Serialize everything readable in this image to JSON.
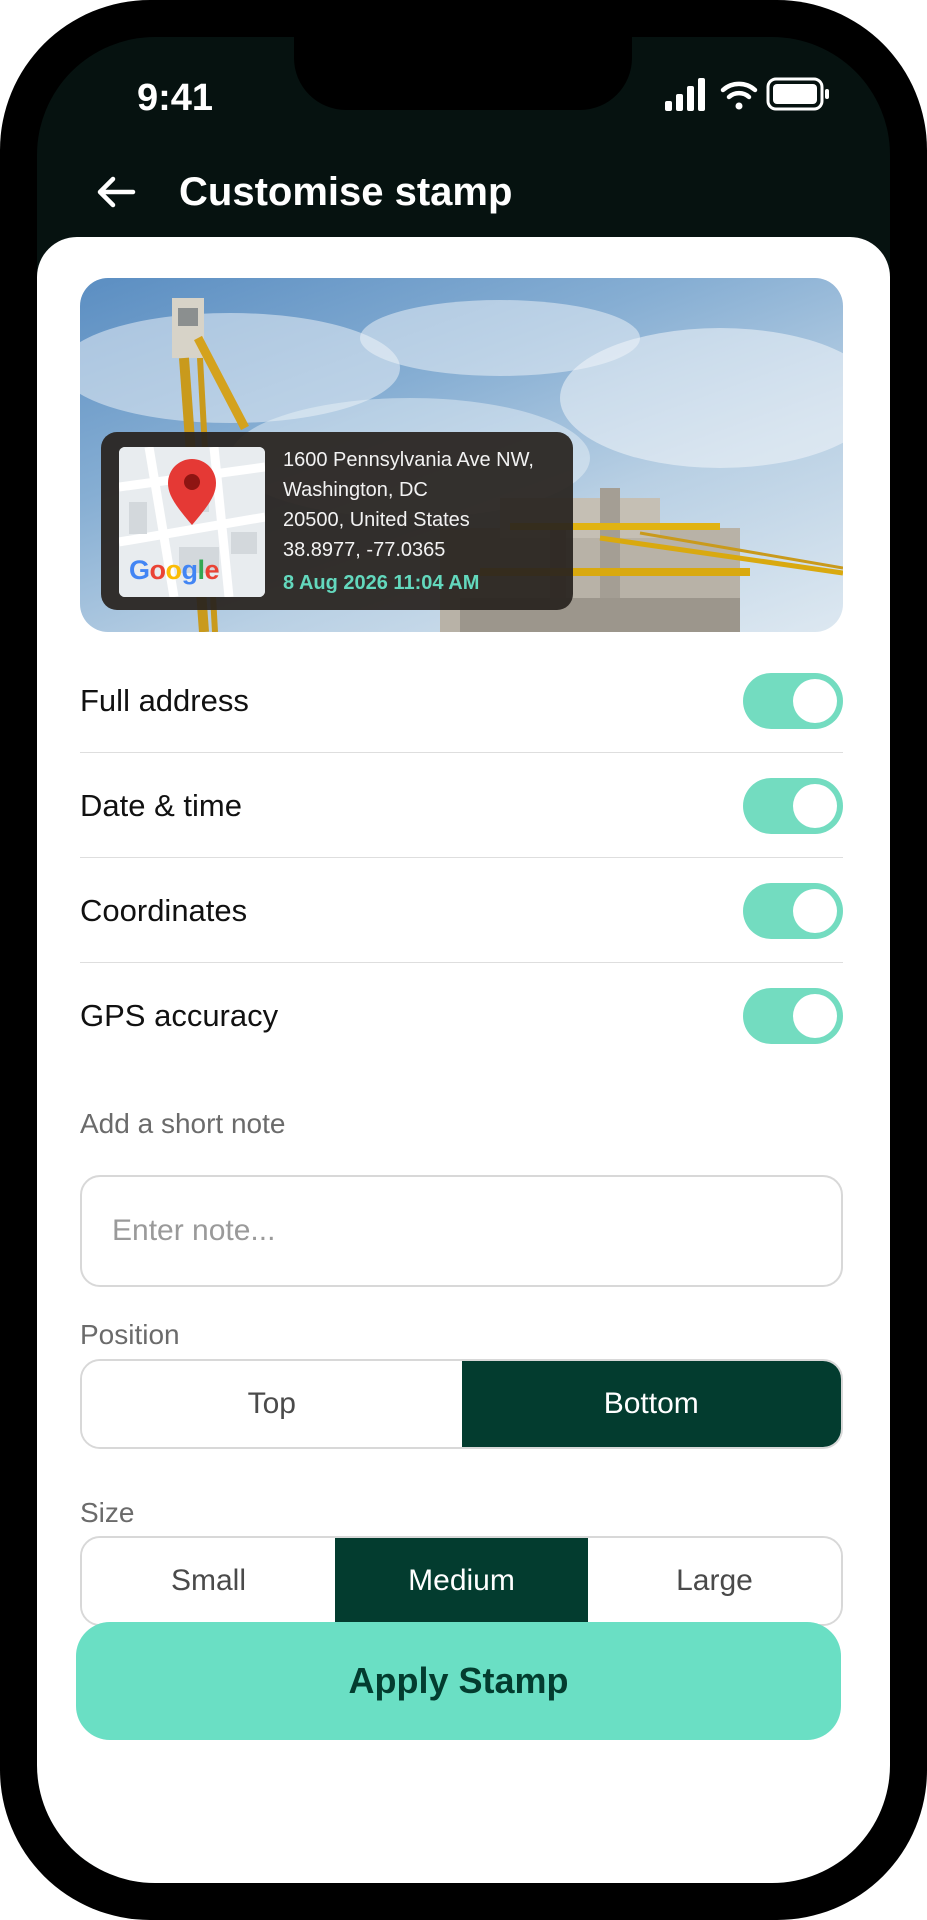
{
  "status_bar": {
    "time": "9:41"
  },
  "header": {
    "title": "Customise stamp"
  },
  "preview": {
    "stamp": {
      "address_lines": [
        "1600 Pennsylvania Ave NW,",
        "Washington, DC",
        "20500, United States"
      ],
      "coordinates": "38.8977, -77.0365",
      "datetime": "8 Aug 2026 11:04 AM",
      "map_logo": "Google"
    }
  },
  "toggles": [
    {
      "label": "Full address",
      "on": true
    },
    {
      "label": "Date & time",
      "on": true
    },
    {
      "label": "Coordinates",
      "on": true
    },
    {
      "label": "GPS accuracy",
      "on": true
    }
  ],
  "note": {
    "label": "Add a short note",
    "placeholder": "Enter note...",
    "value": ""
  },
  "position": {
    "label": "Position",
    "options": [
      "Top",
      "Bottom"
    ],
    "selected": "Bottom"
  },
  "size": {
    "label": "Size",
    "options": [
      "Small",
      "Medium",
      "Large"
    ],
    "selected": "Medium"
  },
  "apply_button": {
    "label": "Apply Stamp"
  },
  "colors": {
    "primary_dark": "#033c2f",
    "accent": "#6adfc4",
    "toggle_on": "#73dcc0",
    "header_bg": "#061210",
    "stamp_date": "#63d8bd"
  },
  "icons": {
    "back": "back-arrow-icon",
    "signal": "cellular-signal-icon",
    "wifi": "wifi-icon",
    "battery": "battery-icon",
    "map_pin": "map-pin-icon"
  }
}
